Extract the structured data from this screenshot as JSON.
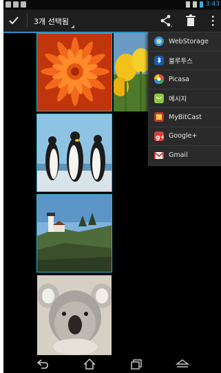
{
  "status_bar": {
    "time": "3:43"
  },
  "action_bar": {
    "selection_title": "3개 선택됨",
    "done_icon": "check-icon",
    "share_icon": "share-icon",
    "delete_icon": "trash-icon",
    "more_icon": "overflow-menu-icon"
  },
  "gallery": {
    "photos": [
      {
        "subject": "orange chrysanthemum flower",
        "selected": true
      },
      {
        "subject": "penguins",
        "selected": true
      },
      {
        "subject": "lighthouse on cliff",
        "selected": true
      },
      {
        "subject": "koala",
        "selected": false
      },
      {
        "subject": "yellow tulips",
        "selected": false
      }
    ]
  },
  "share_menu": {
    "items": [
      {
        "label": "WebStorage",
        "icon": "webstorage-icon",
        "color": "#2e8fd6"
      },
      {
        "label": "블루투스",
        "icon": "bluetooth-icon",
        "color": "#1a5aa8"
      },
      {
        "label": "Picasa",
        "icon": "picasa-icon",
        "color": "#e84c3d"
      },
      {
        "label": "메시지",
        "icon": "message-icon",
        "color": "#8dc63f"
      },
      {
        "label": "MyBitCast",
        "icon": "mybitcast-icon",
        "color": "#c0392b"
      },
      {
        "label": "Google+",
        "icon": "google-plus-icon",
        "color": "#d73d32"
      },
      {
        "label": "Gmail",
        "icon": "gmail-icon",
        "color": "#d14836"
      }
    ]
  },
  "colors": {
    "accent": "#2f8fc6",
    "selection_border": "#2bb5c8"
  }
}
